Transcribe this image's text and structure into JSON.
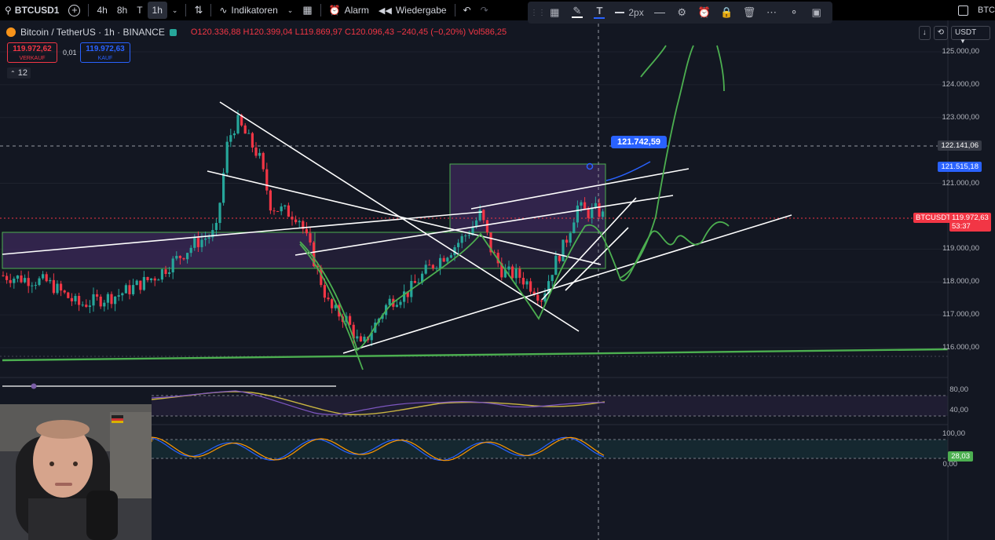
{
  "topbar": {
    "symbol": "BTCUSD1",
    "intervals": [
      "4h",
      "8h",
      "T",
      "1h"
    ],
    "selected_interval": "1h",
    "indicators_label": "Indikatoren",
    "alarm_label": "Alarm",
    "replay_label": "Wiedergabe",
    "right_cut": "BTC"
  },
  "drawbar": {
    "width_label": "2px"
  },
  "legend": {
    "title": "Bitcoin / TetherUS · 1h · BINANCE",
    "open": "O120.336,88",
    "high": "H120.399,04",
    "low": "L119.869,97",
    "close": "C120.096,43",
    "change": "−240,45 (−0,20%)",
    "vol": "Vol586,25"
  },
  "sell": {
    "price": "119.972,62",
    "label": "VERKAUF"
  },
  "buy": {
    "price": "119.972,63",
    "label": "KAUF"
  },
  "spread": "0,01",
  "count_badge": "12",
  "right_controls": {
    "currency": "USDT"
  },
  "price_axis": [
    {
      "label": "125.000,00",
      "v": 125000
    },
    {
      "label": "124.000,00",
      "v": 124000
    },
    {
      "label": "123.000,00",
      "v": 123000
    },
    {
      "label": "121.000,00",
      "v": 121000
    },
    {
      "label": "119.000,00",
      "v": 119000
    },
    {
      "label": "118.000,00",
      "v": 118000
    },
    {
      "label": "117.000,00",
      "v": 117000
    },
    {
      "label": "116.000,00",
      "v": 116000
    }
  ],
  "crosshair_price": "122.141,06",
  "blue_level": "121.515,18",
  "current": {
    "symbol": "BTCUSDT",
    "price": "119.972,63",
    "countdown": "53:37"
  },
  "measure_label": "121.742,59",
  "rsi_axis": [
    "80,00",
    "40,00"
  ],
  "stoch_axis": [
    "100,00",
    "28,03",
    "0,00"
  ],
  "colors": {
    "bg": "#131722",
    "up": "#26a69a",
    "down": "#f23645",
    "drawing_green": "#4caf50",
    "zone_purple": "#3c2a5a",
    "accent_blue": "#2962ff"
  }
}
